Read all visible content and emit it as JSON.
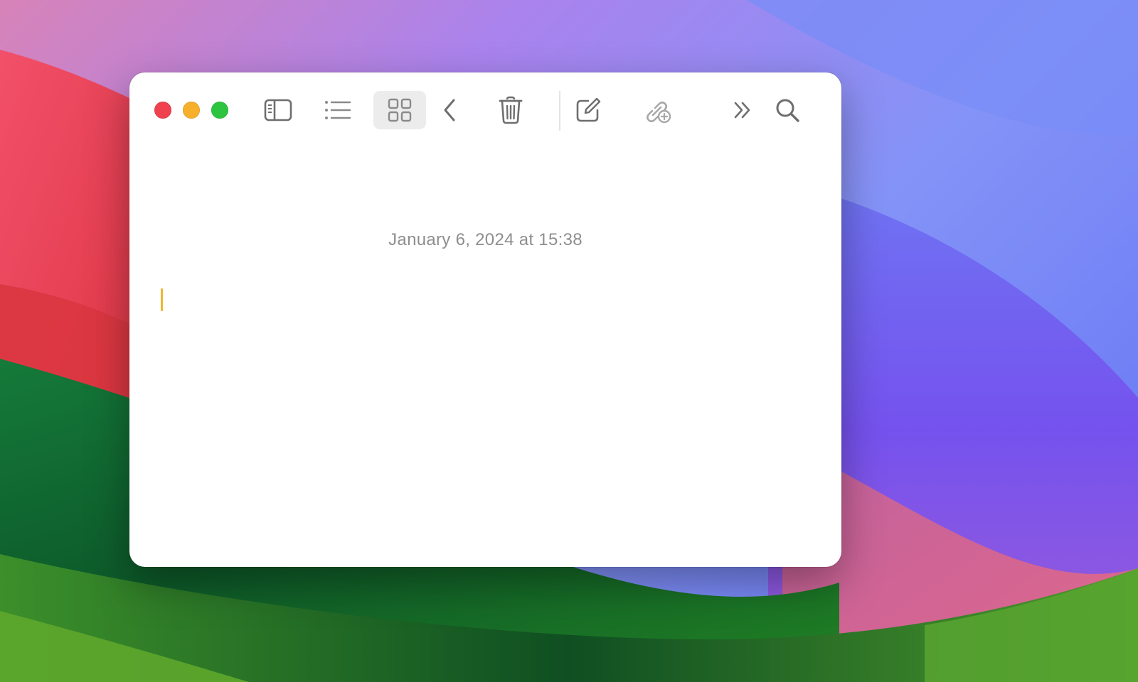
{
  "window": {
    "timestamp": "January 6, 2024 at 15:38",
    "note_text": ""
  },
  "traffic_lights": {
    "close_color": "#f0414e",
    "minimize_color": "#f6b02c",
    "zoom_color": "#2dc540"
  },
  "toolbar": {
    "items": [
      {
        "name": "toggle-sidebar",
        "icon": "sidebar-icon"
      },
      {
        "name": "list-view",
        "icon": "list-icon"
      },
      {
        "name": "gallery-view",
        "icon": "grid-icon",
        "selected": true
      },
      {
        "name": "back",
        "icon": "chevron-left-icon"
      },
      {
        "name": "delete",
        "icon": "trash-icon"
      },
      {
        "name": "new-note",
        "icon": "compose-icon"
      },
      {
        "name": "collaborate",
        "icon": "add-people-icon",
        "disabled": true
      },
      {
        "name": "more",
        "icon": "chevron-double-right-icon"
      },
      {
        "name": "search",
        "icon": "search-icon"
      }
    ]
  },
  "colors": {
    "accent_caret": "#f1b62f",
    "icon": "#6e6e6e",
    "icon_disabled": "#a8a8a8",
    "selected_bg": "#ececec",
    "timestamp_text": "#8e8e8e"
  }
}
